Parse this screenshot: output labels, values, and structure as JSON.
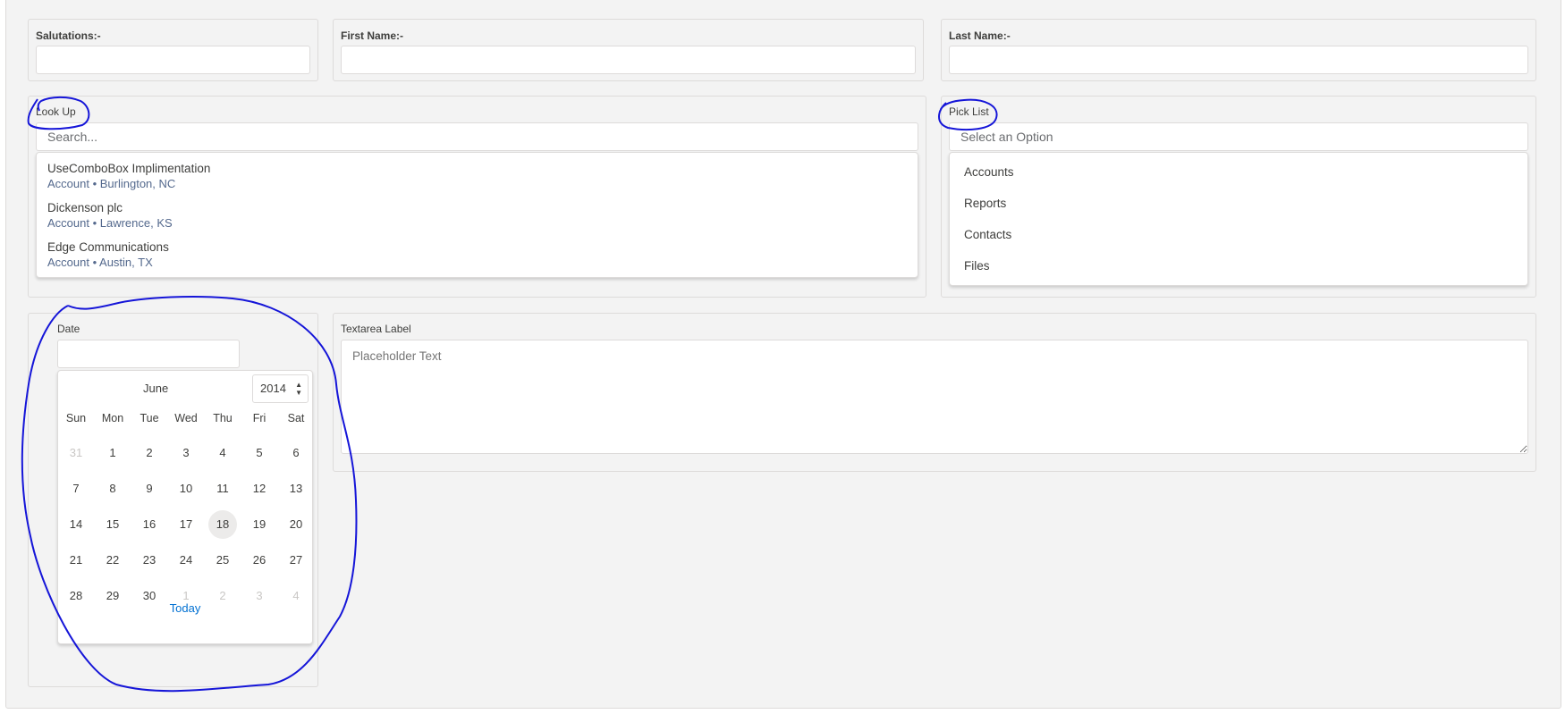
{
  "form": {
    "salutations_label": "Salutations:-",
    "first_name_label": "First Name:-",
    "last_name_label": "Last Name:-",
    "lookup_label": "Look Up",
    "lookup_placeholder": "Search...",
    "lookup_options": [
      {
        "title": "UseComboBox Implimentation",
        "subtitle": "Account • Burlington, NC"
      },
      {
        "title": "Dickenson plc",
        "subtitle": "Account • Lawrence, KS"
      },
      {
        "title": "Edge Communications",
        "subtitle": "Account • Austin, TX"
      }
    ],
    "picklist_label": "Pick List",
    "picklist_placeholder": "Select an Option",
    "picklist_options": [
      "Accounts",
      "Reports",
      "Contacts",
      "Files"
    ],
    "date_label": "Date",
    "textarea_label": "Textarea Label",
    "textarea_placeholder": "Placeholder Text"
  },
  "calendar": {
    "month": "June",
    "year": "2014",
    "weekdays": [
      "Sun",
      "Mon",
      "Tue",
      "Wed",
      "Thu",
      "Fri",
      "Sat"
    ],
    "weeks": [
      [
        "31",
        "1",
        "2",
        "3",
        "4",
        "5",
        "6"
      ],
      [
        "7",
        "8",
        "9",
        "10",
        "11",
        "12",
        "13"
      ],
      [
        "14",
        "15",
        "16",
        "17",
        "18",
        "19",
        "20"
      ],
      [
        "21",
        "22",
        "23",
        "24",
        "25",
        "26",
        "27"
      ],
      [
        "28",
        "29",
        "30",
        "1",
        "2",
        "3",
        "4"
      ]
    ],
    "muted_days": [
      [
        0,
        0
      ],
      [
        4,
        3
      ],
      [
        4,
        4
      ],
      [
        4,
        5
      ],
      [
        4,
        6
      ]
    ],
    "today_cell": [
      2,
      4
    ],
    "today_label": "Today"
  },
  "colors": {
    "annotation": "#1515d8",
    "link": "#0070d2"
  }
}
